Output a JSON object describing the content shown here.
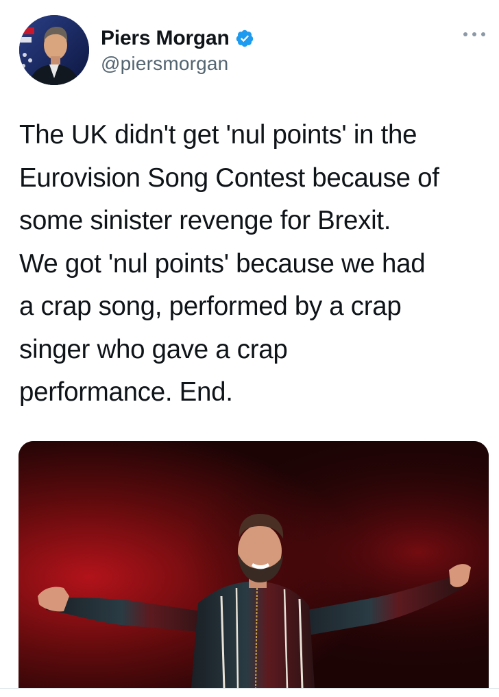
{
  "author": {
    "display_name": "Piers Morgan",
    "handle": "@piersmorgan",
    "verified": true,
    "avatar_icon": "avatar-photo"
  },
  "menu": {
    "icon": "more-dots-icon"
  },
  "tweet": {
    "lines": [
      "The UK didn't get 'nul points' in the",
      "Eurovision Song Contest because of",
      "some sinister revenge for Brexit.",
      "We got 'nul points' because we had",
      "a crap song, performed by a crap",
      "singer who gave a crap",
      "performance. End."
    ]
  },
  "media": {
    "kind": "photo",
    "subject": "singer-on-stage-photo"
  },
  "colors": {
    "text": "#0f1419",
    "secondary": "#536471",
    "verified_blue": "#1d9bf0",
    "divider": "#e1e8ed"
  }
}
